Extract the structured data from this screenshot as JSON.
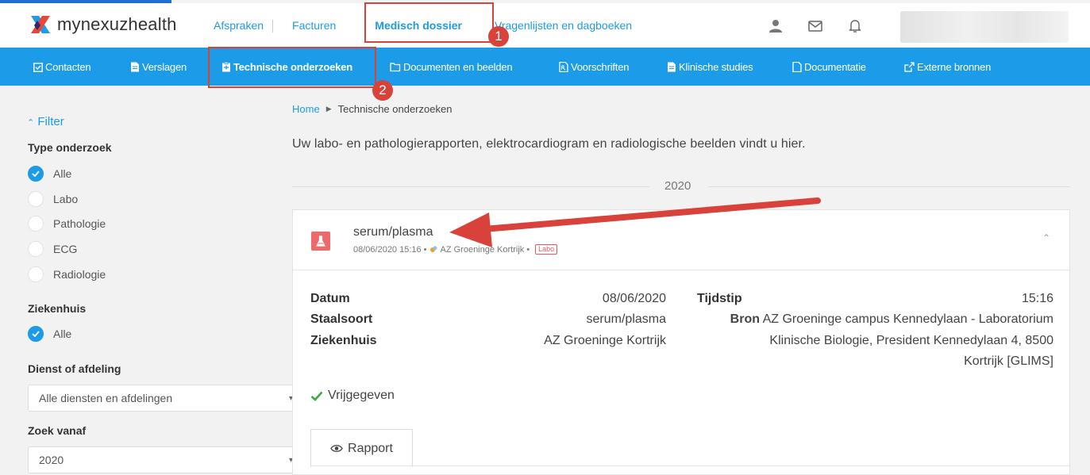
{
  "brand": {
    "name": "mynexuzhealth"
  },
  "topnav": {
    "items": [
      {
        "label": "Afspraken"
      },
      {
        "label": "Facturen"
      },
      {
        "label": "Medisch dossier"
      },
      {
        "label": "Vragenlijsten en dagboeken"
      }
    ],
    "icons": [
      "user-icon",
      "mail-icon",
      "bell-icon"
    ]
  },
  "subnav": {
    "items": [
      {
        "label": "Contacten",
        "icon": "calendar-check-icon"
      },
      {
        "label": "Verslagen",
        "icon": "document-icon"
      },
      {
        "label": "Technische onderzoeken",
        "icon": "clipboard-icon"
      },
      {
        "label": "Documenten en beelden",
        "icon": "folder-icon"
      },
      {
        "label": "Voorschriften",
        "icon": "prescription-icon"
      },
      {
        "label": "Klinische studies",
        "icon": "document-icon"
      },
      {
        "label": "Documentatie",
        "icon": "file-icon"
      },
      {
        "label": "Externe bronnen",
        "icon": "external-link-icon"
      }
    ]
  },
  "annotations": {
    "step1": "1",
    "step2": "2"
  },
  "sidebar": {
    "filter_label": "Filter",
    "type_heading": "Type onderzoek",
    "type_options": [
      {
        "label": "Alle",
        "checked": true
      },
      {
        "label": "Labo",
        "checked": false
      },
      {
        "label": "Pathologie",
        "checked": false
      },
      {
        "label": "ECG",
        "checked": false
      },
      {
        "label": "Radiologie",
        "checked": false
      }
    ],
    "hospital_heading": "Ziekenhuis",
    "hospital_options": [
      {
        "label": "Alle",
        "checked": true
      }
    ],
    "department_heading": "Dienst of afdeling",
    "department_value": "Alle diensten en afdelingen",
    "search_from_heading": "Zoek vanaf",
    "search_from_value": "2020"
  },
  "main": {
    "breadcrumb": {
      "home": "Home",
      "current": "Technische onderzoeken"
    },
    "intro": "Uw labo- en pathologierapporten, elektrocardiogram en radiologische beelden vindt u hier.",
    "year": "2020",
    "card": {
      "title": "serum/plasma",
      "meta_datetime": "08/06/2020 15:16",
      "meta_hospital": "AZ Groeninge Kortrijk",
      "meta_tag": "Labo",
      "fields": {
        "datum_label": "Datum",
        "datum_value": "08/06/2020",
        "staalsoort_label": "Staalsoort",
        "staalsoort_value": "serum/plasma",
        "ziekenhuis_label": "Ziekenhuis",
        "ziekenhuis_value": "AZ Groeninge Kortrijk",
        "tijdstip_label": "Tijdstip",
        "tijdstip_value": "15:16",
        "bron_label": "Bron",
        "bron_line1": "AZ Groeninge campus Kennedylaan - Laboratorium",
        "bron_line2": "Klinische Biologie, President Kennedylaan 4, 8500",
        "bron_line3": "Kortrijk [GLIMS]"
      },
      "status": "Vrijgegeven",
      "report_button": "Rapport"
    }
  },
  "colors": {
    "accent": "#1c9be8",
    "annotation": "#d9423b",
    "labo": "#ec6a6a",
    "success": "#3aa84a"
  }
}
